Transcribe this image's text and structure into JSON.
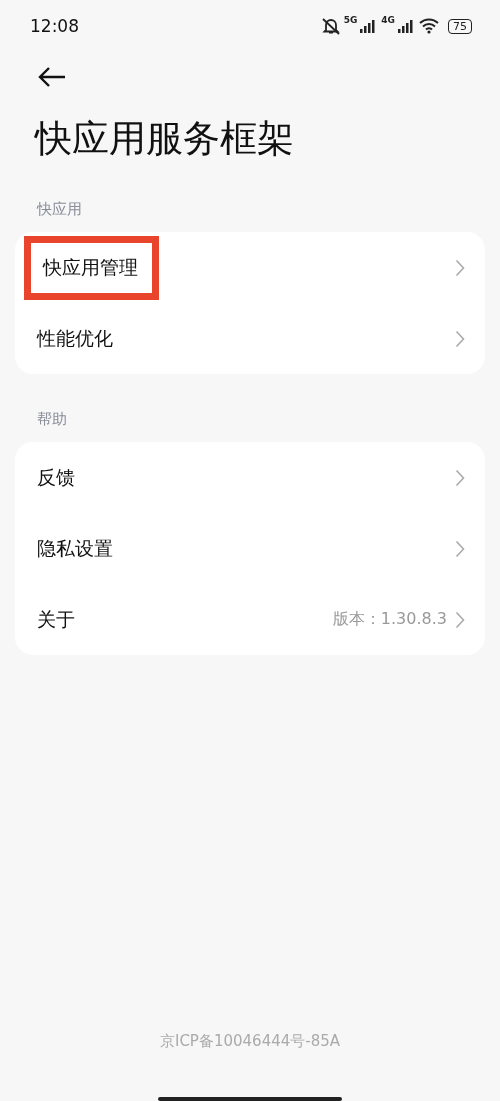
{
  "status_bar": {
    "time": "12:08",
    "network_1": "5G",
    "network_2": "4G",
    "battery": "75"
  },
  "title": "快应用服务框架",
  "sections": [
    {
      "header": "快应用",
      "items": [
        {
          "label": "快应用管理",
          "highlighted": true
        },
        {
          "label": "性能优化",
          "highlighted": false
        }
      ]
    },
    {
      "header": "帮助",
      "items": [
        {
          "label": "反馈",
          "highlighted": false
        },
        {
          "label": "隐私设置",
          "highlighted": false
        },
        {
          "label": "关于",
          "value": "版本：1.30.8.3",
          "highlighted": false
        }
      ]
    }
  ],
  "footer": "京ICP备10046444号-85A"
}
